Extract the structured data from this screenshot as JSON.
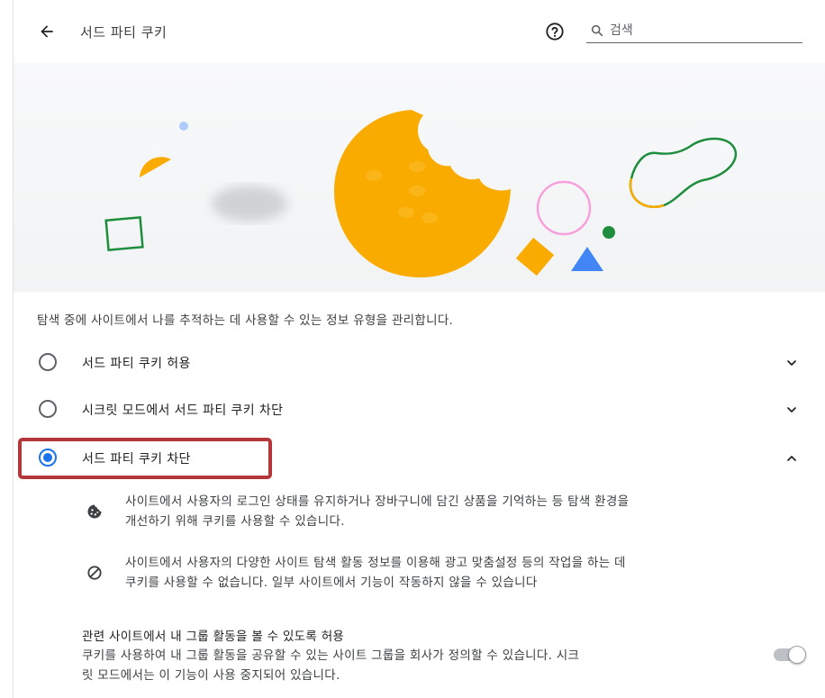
{
  "header": {
    "title": "서드 파티 쿠키",
    "back_icon": "arrow-left-icon",
    "help_icon": "help-circle-icon",
    "search": {
      "placeholder": "검색",
      "value": "",
      "icon": "search-icon"
    }
  },
  "hero": {
    "illustration": "cookie-illustration",
    "colors": {
      "cookie": "#f9ab00",
      "green": "#1e8e3e",
      "pink": "#f7a0dc",
      "blue": "#4285f4",
      "lavender": "#aecbfa"
    }
  },
  "description": "탐색 중에 사이트에서 나를 추적하는 데 사용할 수 있는 정보 유형을 관리합니다.",
  "options": [
    {
      "label": "서드 파티 쿠키 허용",
      "checked": false,
      "expand_icon": "chevron-down-icon"
    },
    {
      "label": "시크릿 모드에서 서드 파티 쿠키 차단",
      "checked": false,
      "expand_icon": "chevron-down-icon"
    },
    {
      "label": "서드 파티 쿠키 차단",
      "checked": true,
      "expand_icon": "chevron-up-icon"
    }
  ],
  "details": [
    {
      "icon": "cookie-icon",
      "line1": "사이트에서 사용자의 로그인 상태를 유지하거나 장바구니에 담긴 상품을 기억하는 등 탐색 환경을",
      "line2": "개선하기 위해 쿠키를 사용할 수 있습니다."
    },
    {
      "icon": "block-icon",
      "line1": "사이트에서 사용자의 다양한 사이트 탐색 활동 정보를 이용해 광고 맞춤설정 등의 작업을 하는 데",
      "line2": "쿠키를 사용할 수 없습니다. 일부 사이트에서 기능이 작동하지 않을 수 있습니다"
    }
  ],
  "related_sites": {
    "title": "관련 사이트에서 내 그룹 활동을 볼 수 있도록 허용",
    "desc_line1": "쿠키를 사용하여 내 그룹 활동을 공유할 수 있는 사이트 그룹을 회사가 정의할 수 있습니다. 시크",
    "desc_line2": "릿 모드에서는 이 기능이 사용 중지되어 있습니다.",
    "toggle_on": false
  },
  "colors": {
    "accent": "#1a73e8",
    "highlight": "#b3363a"
  }
}
